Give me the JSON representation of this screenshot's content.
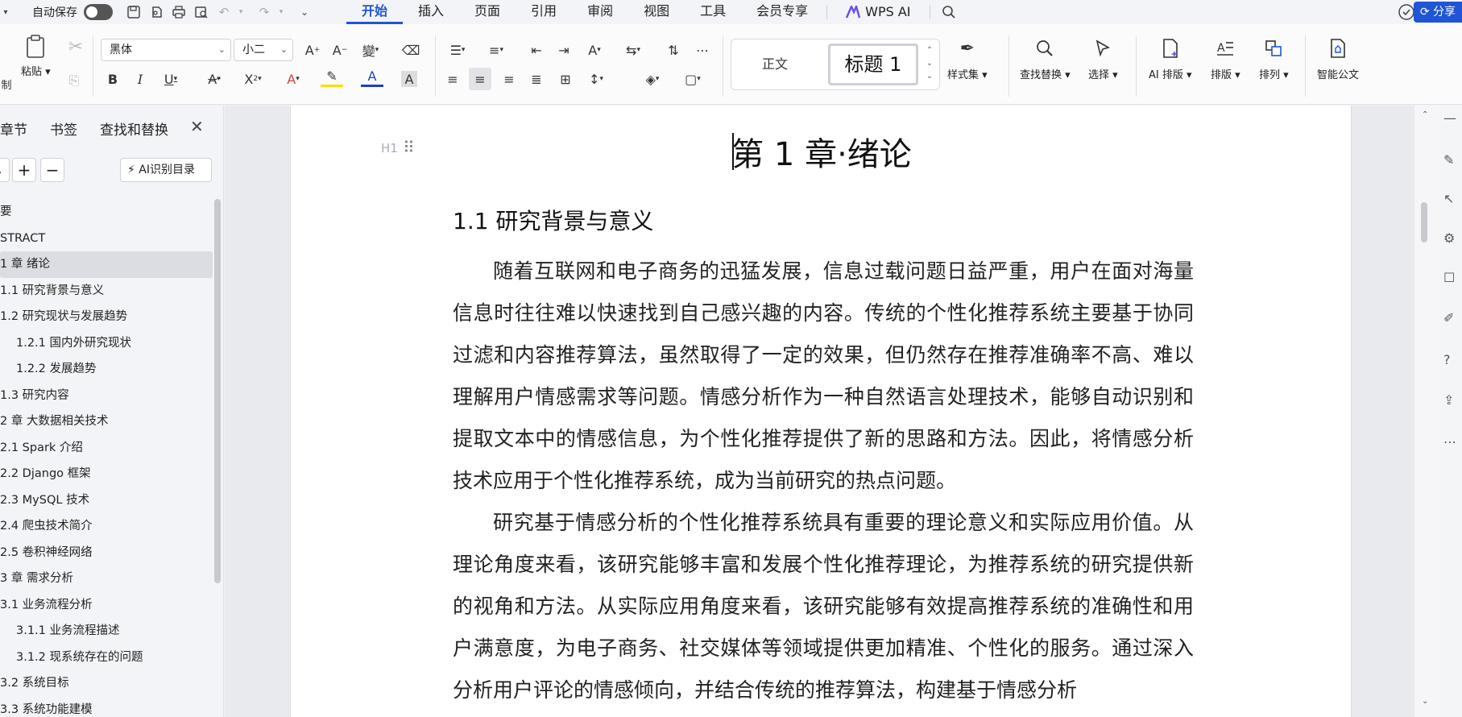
{
  "quick_access": {
    "autosave_label": "自动保存"
  },
  "tabs": [
    {
      "label": "开始",
      "active": true
    },
    {
      "label": "插入"
    },
    {
      "label": "页面"
    },
    {
      "label": "引用"
    },
    {
      "label": "审阅"
    },
    {
      "label": "视图"
    },
    {
      "label": "工具"
    },
    {
      "label": "会员专享"
    },
    {
      "label": "WPS AI"
    }
  ],
  "share_label": "分享",
  "ribbon": {
    "clipboard": {
      "cut_label": "剪切",
      "paste_label": "粘贴"
    },
    "font_name": "黑体",
    "font_size": "小二",
    "style_normal": "正文",
    "style_heading": "标题 1",
    "styles_label": "样式集",
    "find_replace_label": "查找替换",
    "select_label": "选择",
    "ai_layout_label": "AI 排版",
    "layout_label": "排版",
    "arrange_label": "排列",
    "smart_doc_label": "智能公文"
  },
  "side_panel": {
    "tabs": [
      "章节",
      "书签",
      "查找和替换"
    ],
    "ai_toc_label": "AI识别目录",
    "items": [
      {
        "label": "要",
        "level": 1
      },
      {
        "label": "STRACT",
        "level": 1
      },
      {
        "label": "1 章  绪论",
        "level": 1,
        "selected": true
      },
      {
        "label": "1.1 研究背景与意义",
        "level": 2
      },
      {
        "label": "1.2 研究现状与发展趋势",
        "level": 2
      },
      {
        "label": "1.2.1 国内外研究现状",
        "level": 3
      },
      {
        "label": "1.2.2 发展趋势",
        "level": 3
      },
      {
        "label": "1.3 研究内容",
        "level": 2
      },
      {
        "label": "2 章  大数据相关技术",
        "level": 1
      },
      {
        "label": "2.1 Spark 介绍",
        "level": 2
      },
      {
        "label": "2.2 Django 框架",
        "level": 2
      },
      {
        "label": "2.3 MySQL 技术",
        "level": 2
      },
      {
        "label": "2.4  爬虫技术简介",
        "level": 2
      },
      {
        "label": "2.5  卷积神经网络",
        "level": 2
      },
      {
        "label": "3 章  需求分析",
        "level": 1
      },
      {
        "label": "3.1 业务流程分析",
        "level": 2
      },
      {
        "label": "3.1.1 业务流程描述",
        "level": 3
      },
      {
        "label": "3.1.2 现系统存在的问题",
        "level": 3
      },
      {
        "label": "3.2 系统目标",
        "level": 2
      },
      {
        "label": "3.3 系统功能建模",
        "level": 2
      }
    ]
  },
  "document": {
    "heading_mark": "H1",
    "chapter_title": "第 1 章·绪论",
    "section_title": "1.1  研究背景与意义",
    "paragraph1": "随着互联网和电子商务的迅猛发展，信息过载问题日益严重，用户在面对海量信息时往往难以快速找到自己感兴趣的内容。传统的个性化推荐系统主要基于协同过滤和内容推荐算法，虽然取得了一定的效果，但仍然存在推荐准确率不高、难以理解用户情感需求等问题。情感分析作为一种自然语言处理技术，能够自动识别和提取文本中的情感信息，为个性化推荐提供了新的思路和方法。因此，将情感分析技术应用于个性化推荐系统，成为当前研究的热点问题。",
    "paragraph2": "研究基于情感分析的个性化推荐系统具有重要的理论意义和实际应用价值。从理论角度来看，该研究能够丰富和发展个性化推荐理论，为推荐系统的研究提供新的视角和方法。从实际应用角度来看，该研究能够有效提高推荐系统的准确性和用户满意度，为电子商务、社交媒体等领域提供更加精准、个性化的服务。通过深入分析用户评论的情感倾向，并结合传统的推荐算法，构建基于情感分析"
  }
}
